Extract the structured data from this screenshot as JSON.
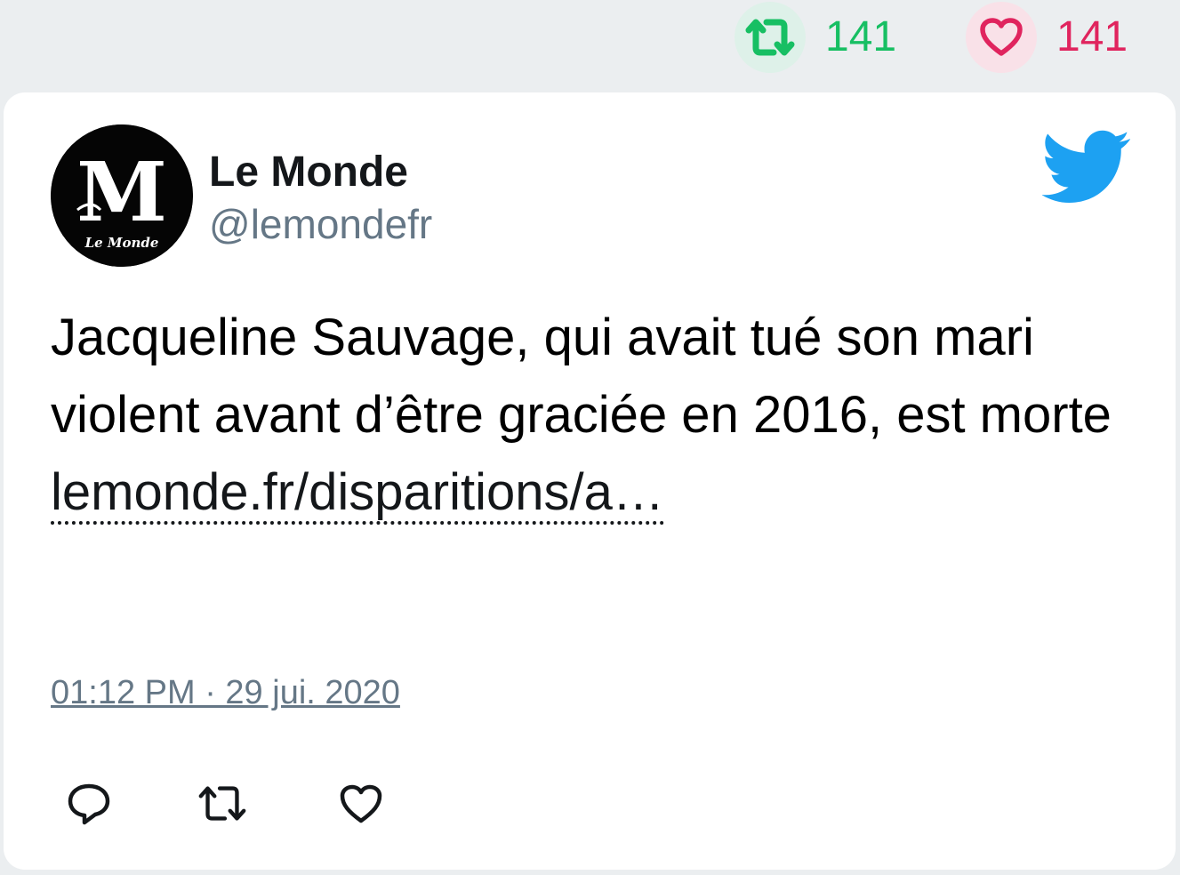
{
  "top_stats": {
    "retweet_count": "141",
    "like_count": "141",
    "retweet_color": "#17bf63",
    "like_color": "#e0245e"
  },
  "tweet": {
    "author_name": "Le Monde",
    "author_handle": "@lemondefr",
    "avatar_icon": "le-monde-logo-icon",
    "platform_icon": "twitter-bird-icon",
    "text": "Jacqueline Sauvage, qui avait tué son mari violent avant d’être graciée en 2016, est morte",
    "link_text": "lemonde.fr/disparitions/a…",
    "timestamp": "01:12 PM · 29 jui. 2020",
    "brand_color": "#1da1f2"
  },
  "actions": [
    {
      "name": "reply",
      "icon": "reply-icon"
    },
    {
      "name": "retweet",
      "icon": "retweet-icon"
    },
    {
      "name": "like",
      "icon": "heart-icon"
    }
  ]
}
